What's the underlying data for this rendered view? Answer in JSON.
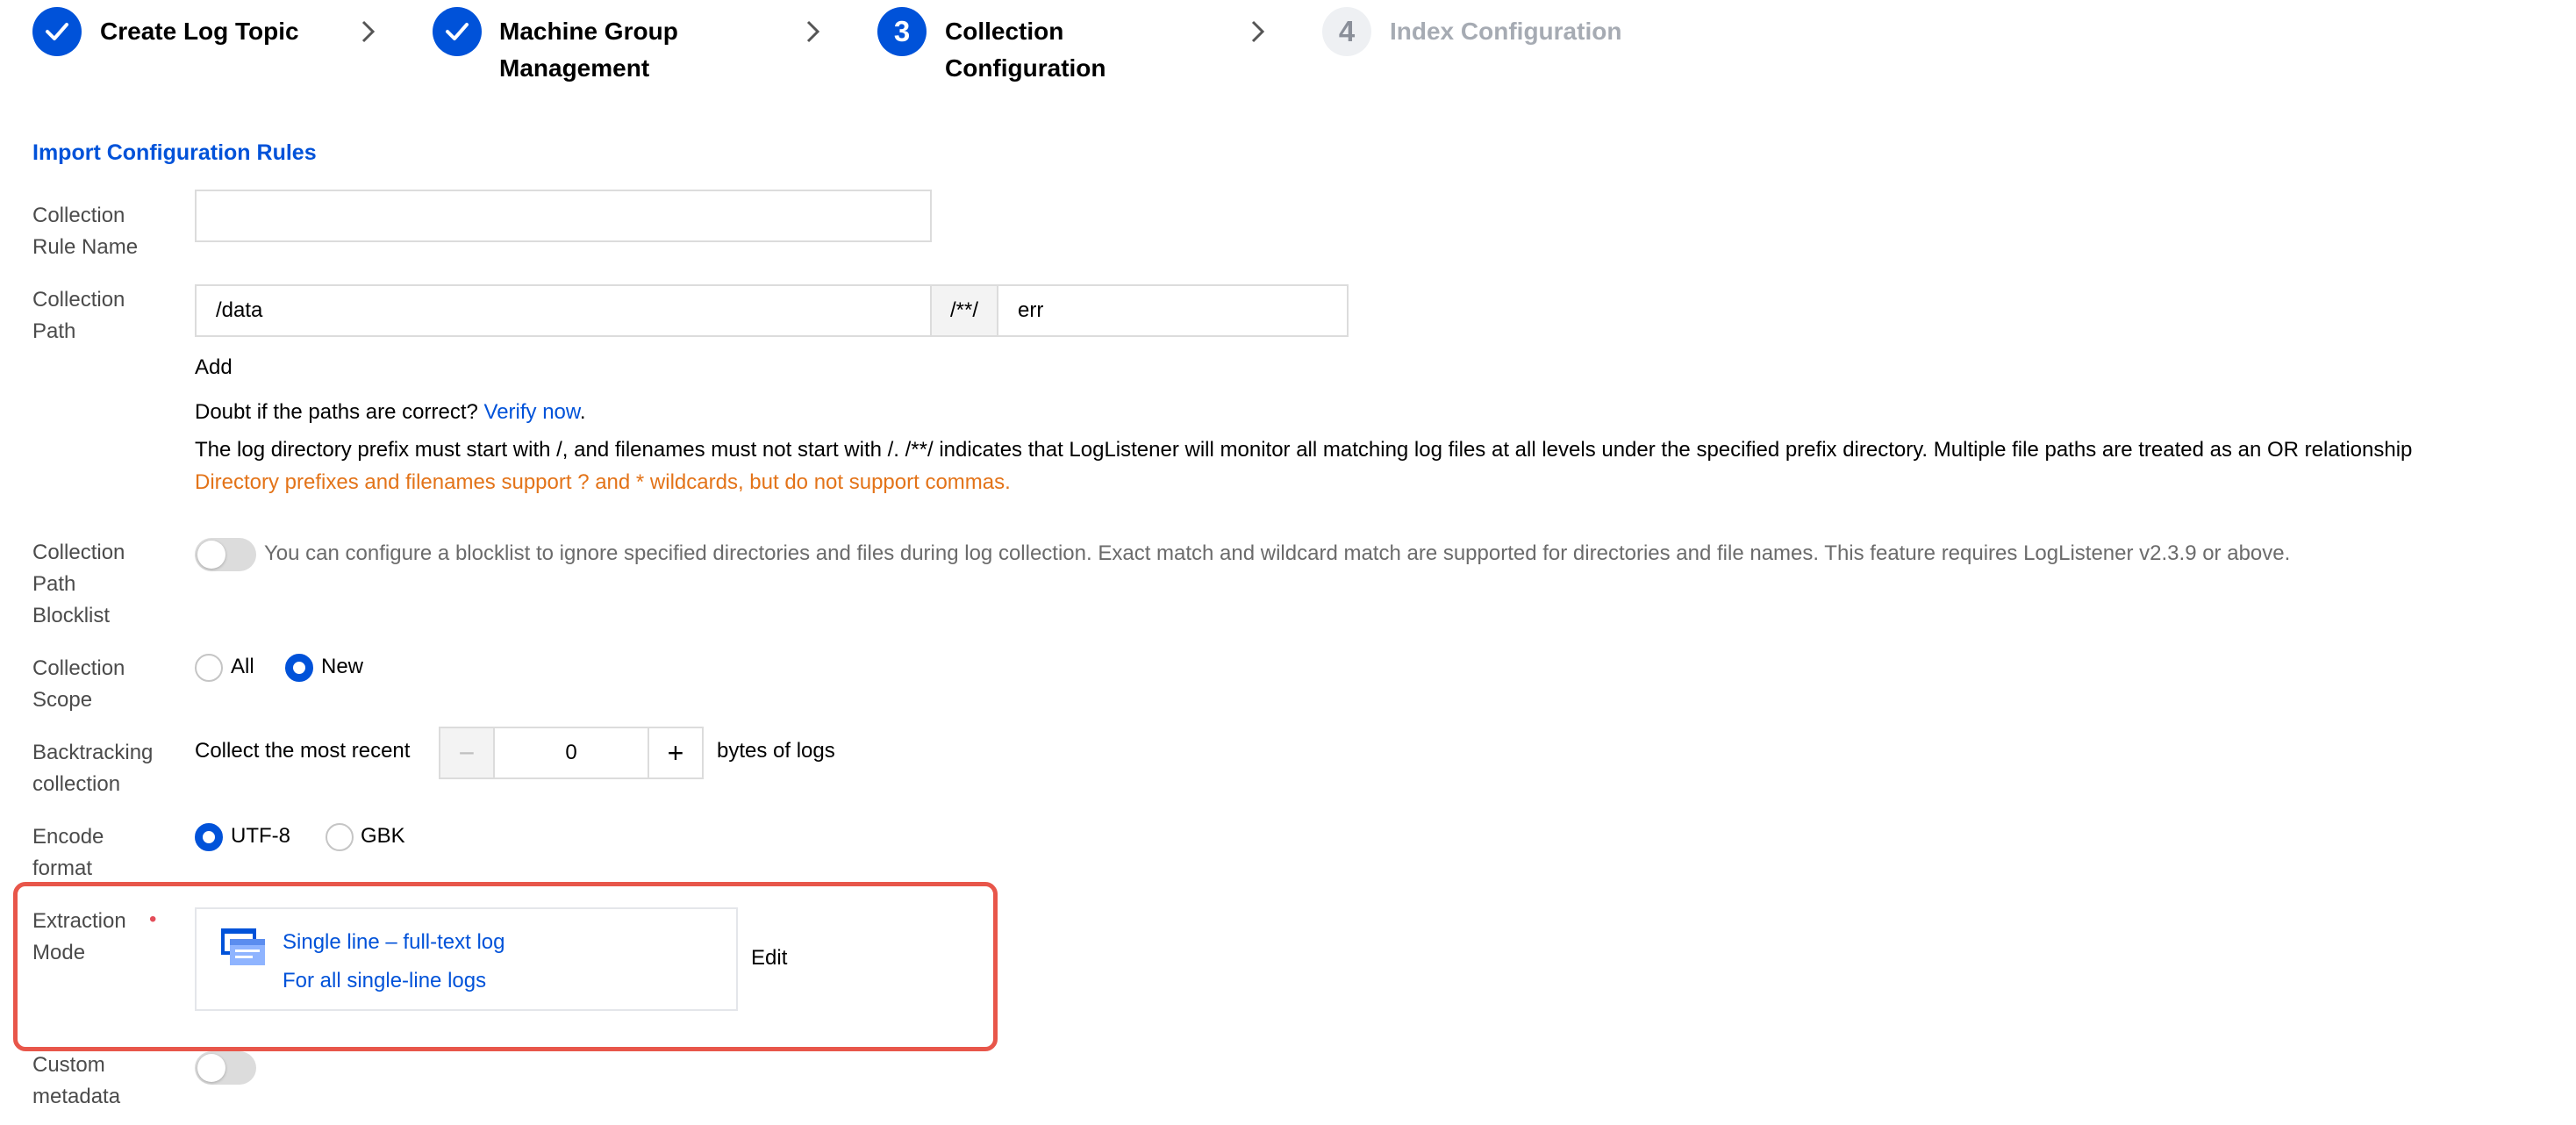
{
  "steps": [
    {
      "label": "Create Log Topic",
      "state": "done"
    },
    {
      "label_line1": "Machine Group",
      "label_line2": "Management",
      "state": "done"
    },
    {
      "number": "3",
      "label_line1": "Collection",
      "label_line2": "Configuration",
      "state": "active"
    },
    {
      "number": "4",
      "label": "Index Configuration",
      "state": "todo"
    }
  ],
  "section_title": "Import Configuration Rules",
  "rule_name": {
    "label_line1": "Collection",
    "label_line2": "Rule Name",
    "value": ""
  },
  "collection_path": {
    "label_line1": "Collection",
    "label_line2": "Path",
    "prefix_value": "/data",
    "separator": "/**/",
    "file_value": "err",
    "add_label": "Add",
    "verify_prompt": "Doubt if the paths are correct?",
    "verify_link": "Verify now",
    "verify_suffix": ".",
    "help_text": "The log directory prefix must start with /, and filenames must not start with /. /**/ indicates that LogListener will monitor all matching log files at all levels under the specified prefix directory. Multiple file paths are treated as an OR relationship",
    "warning_text": "Directory prefixes and filenames support ? and * wildcards, but do not support commas."
  },
  "blocklist": {
    "label_line1": "Collection",
    "label_line2": "Path",
    "label_line3": "Blocklist",
    "enabled": false,
    "description": "You can configure a blocklist to ignore specified directories and files during log collection. Exact match and wildcard match are supported for directories and file names. This feature requires LogListener v2.3.9 or above."
  },
  "scope": {
    "label_line1": "Collection",
    "label_line2": "Scope",
    "options": [
      "All",
      "New"
    ],
    "selected": "New"
  },
  "backtracking": {
    "label_line1": "Backtracking",
    "label_line2": "collection",
    "prefix": "Collect the most recent",
    "value": "0",
    "minus": "−",
    "plus": "+",
    "suffix": "bytes of logs"
  },
  "encode": {
    "label_line1": "Encode",
    "label_line2": "format",
    "options": [
      "UTF-8",
      "GBK"
    ],
    "selected": "UTF-8"
  },
  "extraction": {
    "label_line1": "Extraction",
    "label_line2": "Mode",
    "required_mark": "•",
    "mode_title": "Single line – full-text log",
    "mode_desc": "For all single-line logs",
    "edit_label": "Edit"
  },
  "metadata": {
    "label_line1": "Custom",
    "label_line2": "metadata",
    "enabled": false
  },
  "colors": {
    "primary": "#0052d9",
    "warning": "#e37318",
    "highlight": "#e8564a",
    "required": "#e34d59"
  }
}
